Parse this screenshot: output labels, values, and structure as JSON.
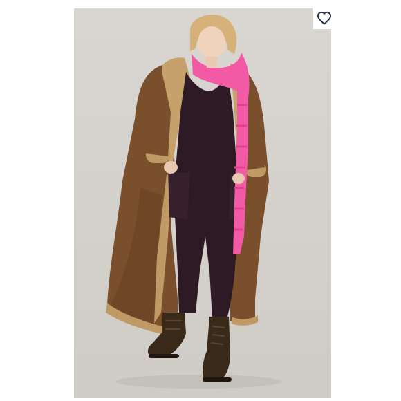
{
  "product_image": {
    "alt": ""
  },
  "favorite": {
    "icon": "heart-outline-icon",
    "selected": false,
    "icon_color": "#1f2a44"
  },
  "colors": {
    "backdrop": "#d6d3ce",
    "coat": "#7a4f2c",
    "shearling": "#c09a64",
    "scarf": "#f25aa5",
    "jumpsuit": "#2e1a24",
    "boots": "#3a2a1a"
  }
}
